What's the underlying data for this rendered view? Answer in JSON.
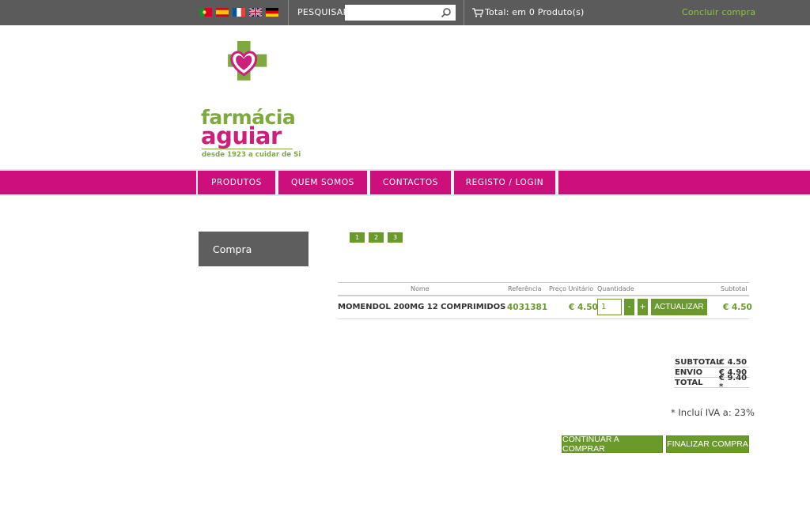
{
  "topbar": {
    "languages": [
      "pt",
      "es",
      "fr",
      "en",
      "de"
    ],
    "search_label": "PESQUISAR",
    "search_placeholder": "",
    "cart_total": "Total: em 0 Produto(s)",
    "checkout_link": "Concluir compra"
  },
  "logo": {
    "line1": "farmácia",
    "line2": "aguiar",
    "tagline": "desde 1923 a cuidar de Si"
  },
  "nav": {
    "items": [
      "PRODUTOS",
      "QUEM SOMOS",
      "CONTACTOS",
      "REGISTO / LOGIN"
    ]
  },
  "sidebar": {
    "title": "Compra"
  },
  "steps": [
    "1",
    "2",
    "3"
  ],
  "cart_table": {
    "headers": {
      "name": "Nome",
      "reference": "Referência",
      "unit_price": "Preço Unitário",
      "quantity": "Quantidade",
      "subtotal": "Subtotal"
    },
    "rows": [
      {
        "name": "MOMENDOL 200MG 12 COMPRIMIDOS",
        "reference": "4031381",
        "unit_price": "€ 4.50",
        "quantity": "1",
        "minus": "-",
        "plus": "+",
        "update": "ACTUALIZAR",
        "subtotal": "€ 4.50"
      }
    ]
  },
  "totals": [
    {
      "label": "SUBTOTAL",
      "value": "€ 4.50"
    },
    {
      "label": "ENVIO",
      "value": "€ 4.90"
    },
    {
      "label": "TOTAL",
      "value": "€ 9.40 *"
    }
  ],
  "iva_note": "* Incluí IVA a: 23%",
  "actions": {
    "continue": "CONTINUAR A COMPRAR",
    "finalize": "FINALIZAR COMPRA"
  },
  "colors": {
    "topbar": "#5b5b5b",
    "brand_magenta": "#cc0f7b",
    "brand_green": "#6a9a2c",
    "checkout_link": "#8cc63f"
  }
}
